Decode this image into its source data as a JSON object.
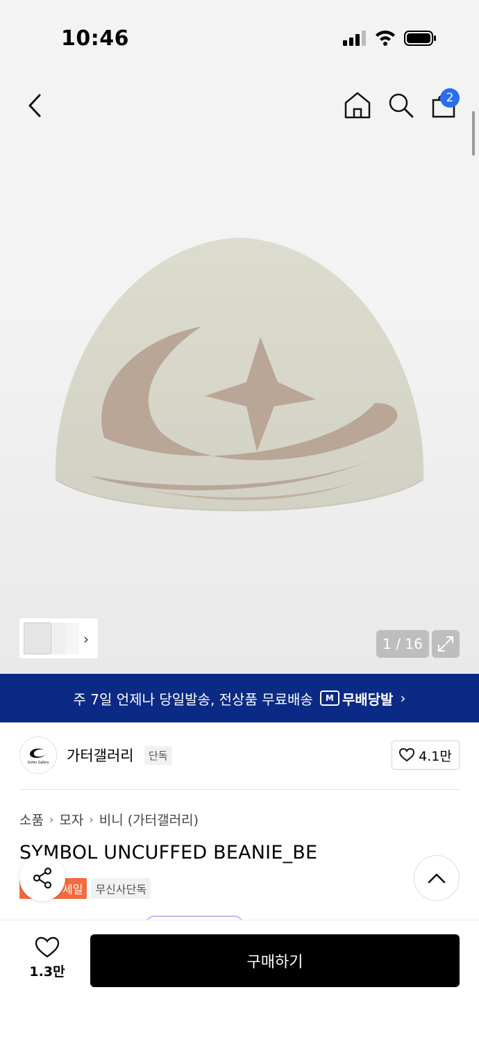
{
  "status_bar": {
    "time": "10:46"
  },
  "nav": {
    "cart_count": "2"
  },
  "gallery": {
    "counter": "1 / 16"
  },
  "banner": {
    "text": "주 7일 언제나 당일발송, 전상품 무료배송",
    "badge": "무배당발",
    "chevron": "›"
  },
  "brand": {
    "logo_text": "Gotter Gallery",
    "name": "가터갤러리",
    "tag": "단독",
    "likes": "4.1만"
  },
  "breadcrumb": {
    "items": [
      "소품",
      "모자",
      "비니 (가터갤러리)"
    ]
  },
  "product": {
    "title": "SYMBOL UNCUFFED BEANIE_BE",
    "tags": [
      "세일",
      "무신사단독"
    ]
  },
  "bottom_bar": {
    "wish_count": "1.3만",
    "buy_label": "구매하기"
  },
  "colors": {
    "banner": "#0b2a86",
    "buy_button": "#000000",
    "sale_tag": "#f26a3d",
    "badge": "#2a6ef0"
  }
}
